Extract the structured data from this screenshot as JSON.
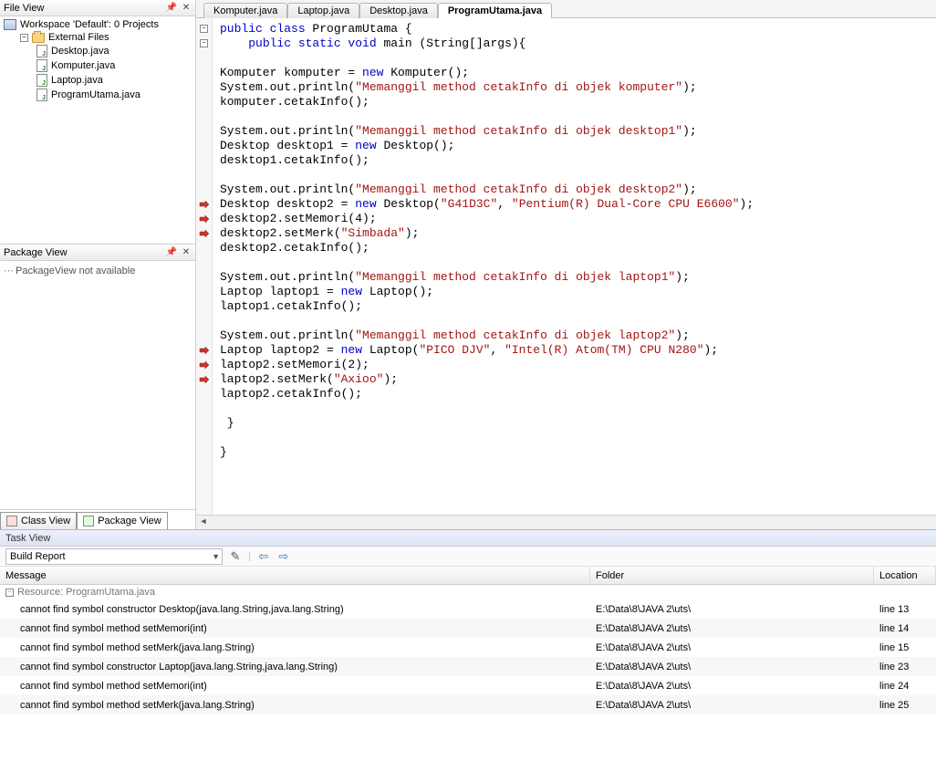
{
  "fileView": {
    "title": "File View",
    "workspace": "Workspace 'Default': 0 Projects",
    "externalFiles": "External Files",
    "files": [
      "Desktop.java",
      "Komputer.java",
      "Laptop.java",
      "ProgramUtama.java"
    ]
  },
  "packageView": {
    "title": "Package View",
    "body": "PackageView not available"
  },
  "bottomTabs": {
    "classView": "Class View",
    "packageView": "Package View"
  },
  "editor": {
    "tabs": [
      "Komputer.java",
      "Laptop.java",
      "Desktop.java",
      "ProgramUtama.java"
    ],
    "activeTab": 3,
    "errorLines": [
      13,
      14,
      15,
      23,
      24,
      25
    ],
    "code": {
      "l1": {
        "pre": "public class ",
        "cls": "ProgramUtama",
        "post": " {"
      },
      "l2": {
        "pre": "    public static void ",
        "m": "main",
        "post": " (String[]args){"
      },
      "l3": "",
      "l4a": "Komputer komputer = ",
      "l4b": "new",
      "l4c": " Komputer();",
      "l5a": "System.out.println(",
      "l5s": "\"Memanggil method cetakInfo di objek komputer\"",
      "l5c": ");",
      "l6": "komputer.cetakInfo();",
      "l7": "",
      "l8a": "System.out.println(",
      "l8s": "\"Memanggil method cetakInfo di objek desktop1\"",
      "l8c": ");",
      "l9a": "Desktop desktop1 = ",
      "l9b": "new",
      "l9c": " Desktop();",
      "l10": "desktop1.cetakInfo();",
      "l11": "",
      "l12a": "System.out.println(",
      "l12s": "\"Memanggil method cetakInfo di objek desktop2\"",
      "l12c": ");",
      "l13a": "Desktop desktop2 = ",
      "l13b": "new",
      "l13c": " Desktop(",
      "l13s1": "\"G41D3C\"",
      "l13d": ", ",
      "l13s2": "\"Pentium(R) Dual-Core CPU E6600\"",
      "l13e": ");",
      "l14a": "desktop2.setMemori(",
      "l14n": "4",
      "l14c": ");",
      "l15a": "desktop2.setMerk(",
      "l15s": "\"Simbada\"",
      "l15c": ");",
      "l16": "desktop2.cetakInfo();",
      "l17": "",
      "l18a": "System.out.println(",
      "l18s": "\"Memanggil method cetakInfo di objek laptop1\"",
      "l18c": ");",
      "l19a": "Laptop laptop1 = ",
      "l19b": "new",
      "l19c": " Laptop();",
      "l20": "laptop1.cetakInfo();",
      "l21": "",
      "l22a": "System.out.println(",
      "l22s": "\"Memanggil method cetakInfo di objek laptop2\"",
      "l22c": ");",
      "l23a": "Laptop laptop2 = ",
      "l23b": "new",
      "l23c": " Laptop(",
      "l23s1": "\"PICO DJV\"",
      "l23d": ", ",
      "l23s2": "\"Intel(R) Atom(TM) CPU N280\"",
      "l23e": ");",
      "l24a": "laptop2.setMemori(",
      "l24n": "2",
      "l24c": ");",
      "l25a": "laptop2.setMerk(",
      "l25s": "\"Axioo\"",
      "l25c": ");",
      "l26": "laptop2.cetakInfo();",
      "l27": "",
      "l28": " }",
      "l29": "",
      "l30": "}"
    }
  },
  "taskView": {
    "title": "Task View",
    "combo": "Build Report",
    "columns": {
      "msg": "Message",
      "folder": "Folder",
      "loc": "Location"
    },
    "resource": "Resource: ProgramUtama.java",
    "rows": [
      {
        "msg": "cannot find symbol constructor Desktop(java.lang.String,java.lang.String)",
        "folder": "E:\\Data\\8\\JAVA 2\\uts\\",
        "loc": "line 13"
      },
      {
        "msg": "cannot find symbol method setMemori(int)",
        "folder": "E:\\Data\\8\\JAVA 2\\uts\\",
        "loc": "line 14"
      },
      {
        "msg": "cannot find symbol method setMerk(java.lang.String)",
        "folder": "E:\\Data\\8\\JAVA 2\\uts\\",
        "loc": "line 15"
      },
      {
        "msg": "cannot find symbol constructor Laptop(java.lang.String,java.lang.String)",
        "folder": "E:\\Data\\8\\JAVA 2\\uts\\",
        "loc": "line 23"
      },
      {
        "msg": "cannot find symbol method setMemori(int)",
        "folder": "E:\\Data\\8\\JAVA 2\\uts\\",
        "loc": "line 24"
      },
      {
        "msg": "cannot find symbol method setMerk(java.lang.String)",
        "folder": "E:\\Data\\8\\JAVA 2\\uts\\",
        "loc": "line 25"
      }
    ]
  }
}
